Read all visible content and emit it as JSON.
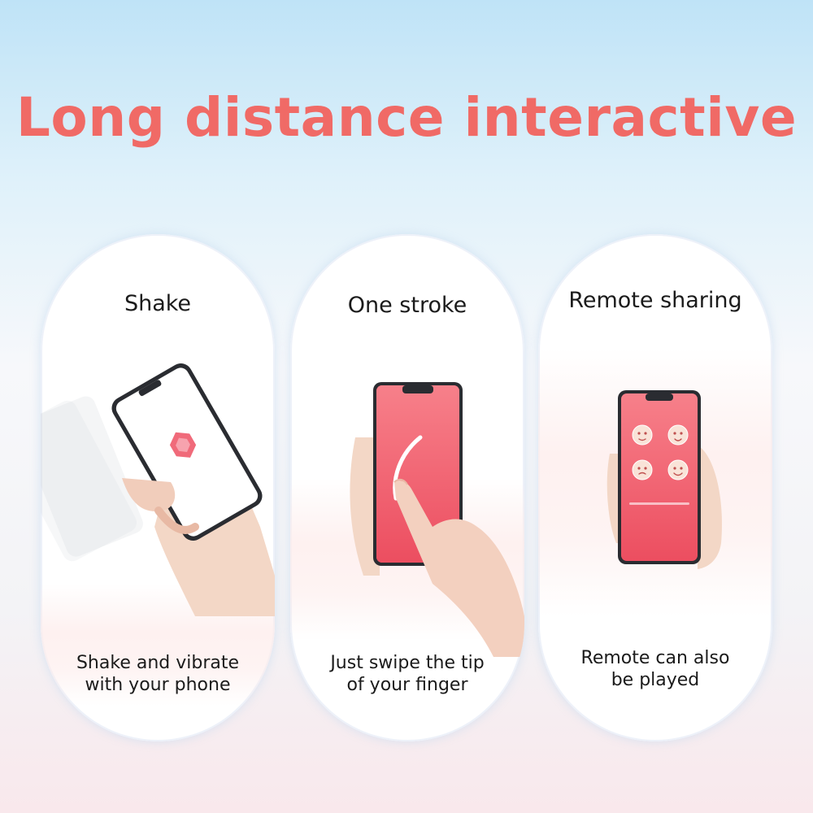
{
  "headline": "Long distance interactive",
  "colors": {
    "accent": "#f06a66",
    "phone_screen": "#f2606a",
    "phone_body": "#222428"
  },
  "cards": [
    {
      "title": "Shake",
      "desc_line1": "Shake and vibrate",
      "desc_line2": "with your phone"
    },
    {
      "title": "One stroke",
      "desc_line1": "Just swipe the tip",
      "desc_line2": "of your finger"
    },
    {
      "title": "Remote sharing",
      "desc_line1": "Remote can also",
      "desc_line2": "be played"
    }
  ]
}
